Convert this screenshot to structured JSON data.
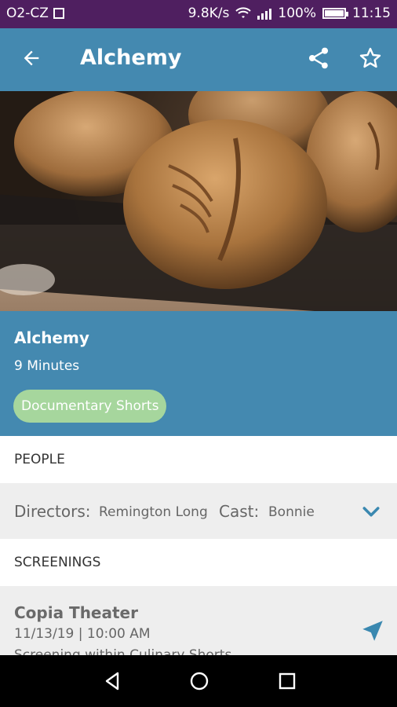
{
  "status_bar": {
    "carrier": "O2-CZ",
    "speed": "9.8K/s",
    "battery": "100%",
    "time": "11:15"
  },
  "app_bar": {
    "title": "Alchemy",
    "back_icon": "arrow-back-icon",
    "share_icon": "share-icon",
    "favorite_icon": "star-outline-icon"
  },
  "film": {
    "title": "Alchemy",
    "duration": "9 Minutes",
    "category": "Documentary Shorts"
  },
  "people": {
    "header": "PEOPLE",
    "directors_label": "Directors:",
    "directors_value": "Remington Long",
    "cast_label": "Cast:",
    "cast_value": "Bonnie"
  },
  "screenings": {
    "header": "SCREENINGS",
    "items": [
      {
        "venue": "Copia Theater",
        "datetime": "11/13/19 | 10:00 AM",
        "note": "Screening within Culinary Shorts"
      }
    ]
  },
  "colors": {
    "status_bar": "#4f1f60",
    "primary": "#4489b0",
    "chip": "#a6d69d",
    "row_bg": "#eeeeee",
    "icon_accent": "#3a88b0"
  }
}
